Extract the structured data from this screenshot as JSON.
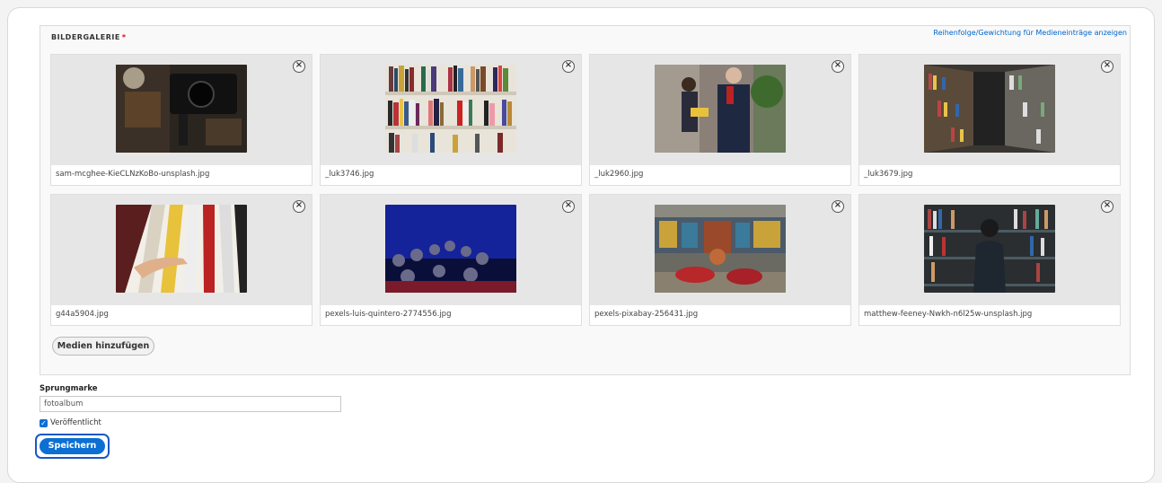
{
  "gallery": {
    "legend": "BILDERGALERIE",
    "required_marker": "*",
    "order_link": "Reihenfolge/Gewichtung für Medieneinträge anzeigen",
    "remove_symbol": "×",
    "items": [
      {
        "filename": "sam-mcghee-KieCLNzKoBo-unsplash.jpg",
        "thumb_icon": "camera-studio-photo"
      },
      {
        "filename": "_luk3746.jpg",
        "thumb_icon": "bookshelf-photo"
      },
      {
        "filename": "_luk2960.jpg",
        "thumb_icon": "people-reading-photo"
      },
      {
        "filename": "_luk3679.jpg",
        "thumb_icon": "library-shelves-photo"
      },
      {
        "filename": "g44a5904.jpg",
        "thumb_icon": "hand-on-books-photo"
      },
      {
        "filename": "pexels-luis-quintero-2774556.jpg",
        "thumb_icon": "audience-photo"
      },
      {
        "filename": "pexels-pixabay-256431.jpg",
        "thumb_icon": "library-interior-photo"
      },
      {
        "filename": "matthew-feeney-Nwkh-n6l25w-unsplash.jpg",
        "thumb_icon": "person-at-shelves-photo"
      }
    ],
    "add_button": "Medien hinzufügen"
  },
  "anchor": {
    "label": "Sprungmarke",
    "value": "fotoalbum"
  },
  "published": {
    "label": "Veröffentlicht",
    "checked": true
  },
  "save_button": "Speichern",
  "colors": {
    "accent": "#0b6fd4",
    "required": "#e00000",
    "link": "#0066cc"
  }
}
